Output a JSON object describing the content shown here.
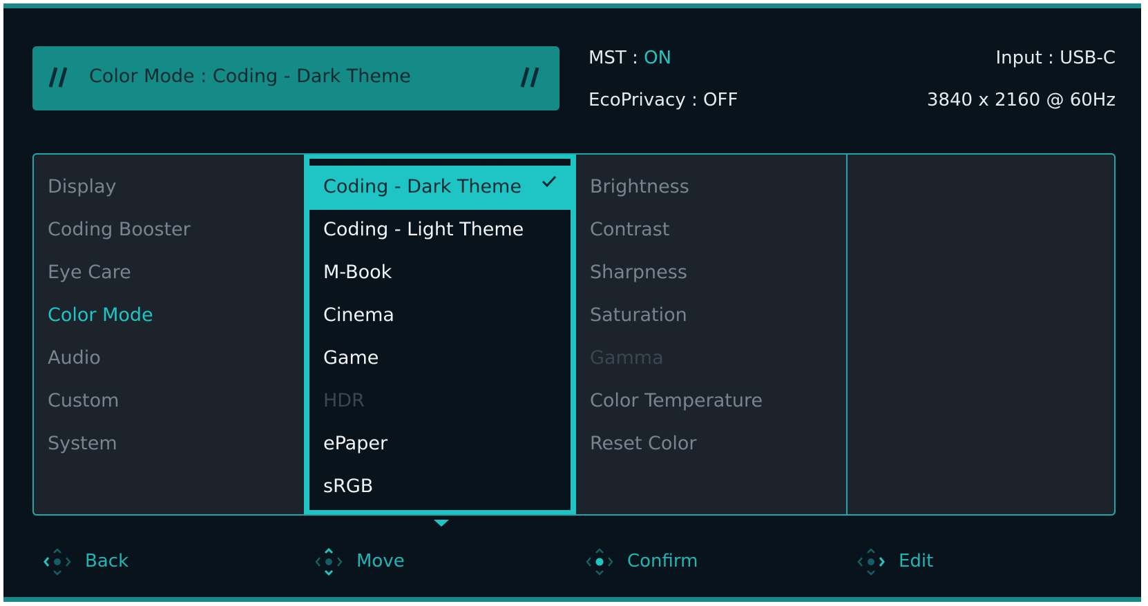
{
  "header": {
    "title": "Color Mode : Coding - Dark Theme",
    "mst_label": "MST : ",
    "mst_value": "ON",
    "ecoprivacy": "EcoPrivacy : OFF",
    "input": "Input : USB-C",
    "resolution": "3840 x 2160 @ 60Hz"
  },
  "colors": {
    "accent": "#1fc4c4",
    "title_bar": "#158b88",
    "background": "#08131b",
    "panel": "#1c232b"
  },
  "menu": {
    "main_items": [
      {
        "label": "Display"
      },
      {
        "label": "Coding Booster"
      },
      {
        "label": "Eye Care"
      },
      {
        "label": "Color Mode",
        "active": true
      },
      {
        "label": "Audio"
      },
      {
        "label": "Custom"
      },
      {
        "label": "System"
      }
    ],
    "color_modes": [
      {
        "label": "Coding - Dark Theme",
        "selected": true
      },
      {
        "label": "Coding - Light Theme"
      },
      {
        "label": "M-Book"
      },
      {
        "label": "Cinema"
      },
      {
        "label": "Game"
      },
      {
        "label": "HDR",
        "disabled": true
      },
      {
        "label": "ePaper"
      },
      {
        "label": "sRGB"
      }
    ],
    "settings": [
      {
        "label": "Brightness"
      },
      {
        "label": "Contrast"
      },
      {
        "label": "Sharpness"
      },
      {
        "label": "Saturation"
      },
      {
        "label": "Gamma",
        "disabled": true
      },
      {
        "label": "Color Temperature"
      },
      {
        "label": "Reset Color"
      }
    ]
  },
  "footer": {
    "back": "Back",
    "move": "Move",
    "confirm": "Confirm",
    "edit": "Edit"
  }
}
